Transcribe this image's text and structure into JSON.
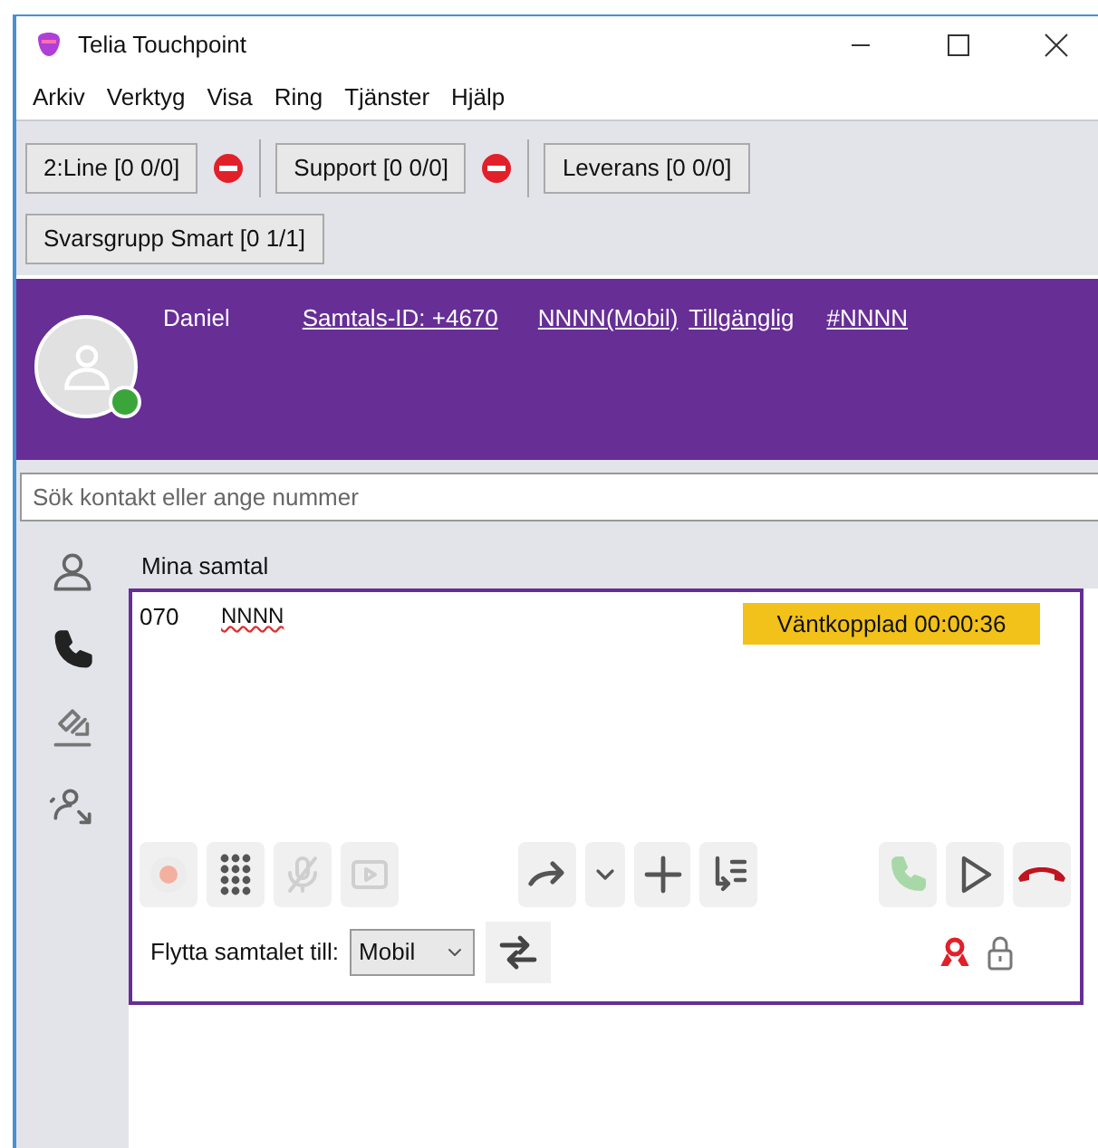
{
  "window": {
    "title": "Telia Touchpoint"
  },
  "menu": [
    "Arkiv",
    "Verktyg",
    "Visa",
    "Ring",
    "Tjänster",
    "Hjälp"
  ],
  "queues": [
    {
      "label": "2:Line [0 0/0]",
      "blocked": true
    },
    {
      "label": "Support [0 0/0]",
      "blocked": true
    },
    {
      "label": "Leverans [0 0/0]",
      "blocked": false
    },
    {
      "label": "Svarsgrupp Smart [0 1/1]",
      "blocked": false
    }
  ],
  "profile": {
    "name": "Daniel",
    "online": true,
    "links": [
      "Samtals-ID: +4670",
      "NNNN(Mobil)",
      "Tillgänglig",
      "#NNNN"
    ]
  },
  "search": {
    "placeholder": "Sök kontakt eller ange nummer"
  },
  "sidebar": {
    "items": [
      {
        "kind": "contact"
      },
      {
        "kind": "phone"
      },
      {
        "kind": "pickup"
      },
      {
        "kind": "transfer"
      }
    ]
  },
  "calls": {
    "title": "Mina samtal",
    "number": "070",
    "name": "NNNN",
    "status": "Väntkopplad 00:00:36"
  },
  "controls": [
    {
      "kind": "record",
      "disabled": true
    },
    {
      "kind": "keypad",
      "disabled": false
    },
    {
      "kind": "mute",
      "disabled": true
    },
    {
      "kind": "video",
      "disabled": true
    },
    {
      "kind": "gap"
    },
    {
      "kind": "forward",
      "disabled": false
    },
    {
      "kind": "caret",
      "disabled": false
    },
    {
      "kind": "plus",
      "disabled": false
    },
    {
      "kind": "transfer-list",
      "disabled": false
    },
    {
      "kind": "gap"
    },
    {
      "kind": "answer",
      "disabled": true
    },
    {
      "kind": "play",
      "disabled": false
    },
    {
      "kind": "hangup",
      "disabled": false
    }
  ],
  "move": {
    "label": "Flytta samtalet till:",
    "value": "Mobil"
  }
}
